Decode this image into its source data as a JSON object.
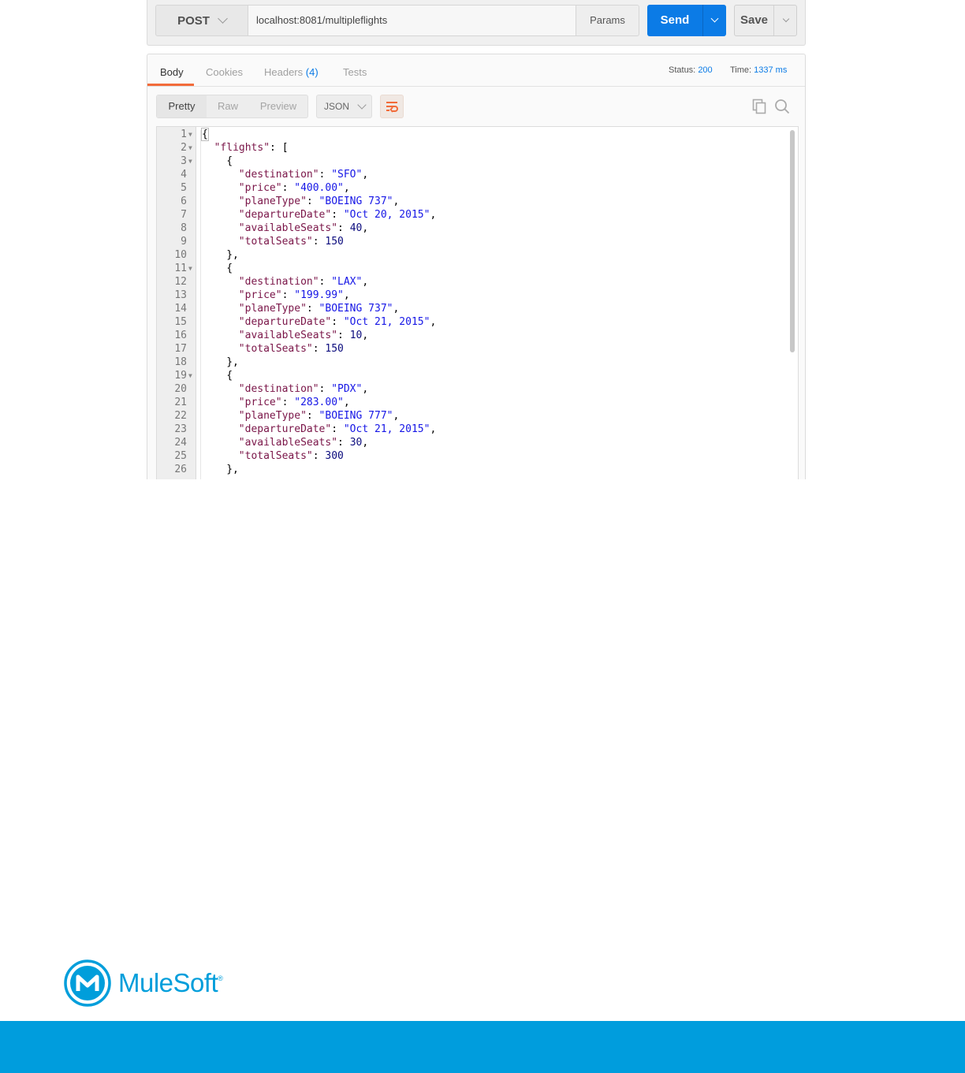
{
  "request": {
    "method": "POST",
    "url": "localhost:8081/multipleflights",
    "params_label": "Params",
    "send_label": "Send",
    "save_label": "Save"
  },
  "response": {
    "tabs": [
      {
        "label": "Body",
        "active": true
      },
      {
        "label": "Cookies"
      },
      {
        "label": "Headers",
        "count": "(4)"
      },
      {
        "label": "Tests"
      }
    ],
    "status_label": "Status:",
    "status_value": "200",
    "time_label": "Time:",
    "time_value": "1337 ms",
    "view_modes": [
      "Pretty",
      "Raw",
      "Preview"
    ],
    "format": "JSON",
    "icons": [
      "wrap-lines-icon",
      "copy-icon",
      "search-icon"
    ]
  },
  "editor": {
    "lines": [
      {
        "n": "1",
        "fold": true,
        "indent": 0,
        "parts": [
          {
            "t": "p",
            "v": "{"
          }
        ]
      },
      {
        "n": "2",
        "fold": true,
        "indent": 1,
        "parts": [
          {
            "t": "k",
            "v": "\"flights\""
          },
          {
            "t": "p",
            "v": ": ["
          }
        ]
      },
      {
        "n": "3",
        "fold": true,
        "indent": 2,
        "parts": [
          {
            "t": "p",
            "v": "{"
          }
        ]
      },
      {
        "n": "4",
        "indent": 3,
        "parts": [
          {
            "t": "k",
            "v": "\"destination\""
          },
          {
            "t": "p",
            "v": ": "
          },
          {
            "t": "s",
            "v": "\"SFO\""
          },
          {
            "t": "p",
            "v": ","
          }
        ]
      },
      {
        "n": "5",
        "indent": 3,
        "parts": [
          {
            "t": "k",
            "v": "\"price\""
          },
          {
            "t": "p",
            "v": ": "
          },
          {
            "t": "s",
            "v": "\"400.00\""
          },
          {
            "t": "p",
            "v": ","
          }
        ]
      },
      {
        "n": "6",
        "indent": 3,
        "parts": [
          {
            "t": "k",
            "v": "\"planeType\""
          },
          {
            "t": "p",
            "v": ": "
          },
          {
            "t": "s",
            "v": "\"BOEING 737\""
          },
          {
            "t": "p",
            "v": ","
          }
        ]
      },
      {
        "n": "7",
        "indent": 3,
        "parts": [
          {
            "t": "k",
            "v": "\"departureDate\""
          },
          {
            "t": "p",
            "v": ": "
          },
          {
            "t": "s",
            "v": "\"Oct 20, 2015\""
          },
          {
            "t": "p",
            "v": ","
          }
        ]
      },
      {
        "n": "8",
        "indent": 3,
        "parts": [
          {
            "t": "k",
            "v": "\"availableSeats\""
          },
          {
            "t": "p",
            "v": ": "
          },
          {
            "t": "n",
            "v": "40"
          },
          {
            "t": "p",
            "v": ","
          }
        ]
      },
      {
        "n": "9",
        "indent": 3,
        "parts": [
          {
            "t": "k",
            "v": "\"totalSeats\""
          },
          {
            "t": "p",
            "v": ": "
          },
          {
            "t": "n",
            "v": "150"
          }
        ]
      },
      {
        "n": "10",
        "indent": 2,
        "parts": [
          {
            "t": "p",
            "v": "},"
          }
        ]
      },
      {
        "n": "11",
        "fold": true,
        "indent": 2,
        "parts": [
          {
            "t": "p",
            "v": "{"
          }
        ]
      },
      {
        "n": "12",
        "indent": 3,
        "parts": [
          {
            "t": "k",
            "v": "\"destination\""
          },
          {
            "t": "p",
            "v": ": "
          },
          {
            "t": "s",
            "v": "\"LAX\""
          },
          {
            "t": "p",
            "v": ","
          }
        ]
      },
      {
        "n": "13",
        "indent": 3,
        "parts": [
          {
            "t": "k",
            "v": "\"price\""
          },
          {
            "t": "p",
            "v": ": "
          },
          {
            "t": "s",
            "v": "\"199.99\""
          },
          {
            "t": "p",
            "v": ","
          }
        ]
      },
      {
        "n": "14",
        "indent": 3,
        "parts": [
          {
            "t": "k",
            "v": "\"planeType\""
          },
          {
            "t": "p",
            "v": ": "
          },
          {
            "t": "s",
            "v": "\"BOEING 737\""
          },
          {
            "t": "p",
            "v": ","
          }
        ]
      },
      {
        "n": "15",
        "indent": 3,
        "parts": [
          {
            "t": "k",
            "v": "\"departureDate\""
          },
          {
            "t": "p",
            "v": ": "
          },
          {
            "t": "s",
            "v": "\"Oct 21, 2015\""
          },
          {
            "t": "p",
            "v": ","
          }
        ]
      },
      {
        "n": "16",
        "indent": 3,
        "parts": [
          {
            "t": "k",
            "v": "\"availableSeats\""
          },
          {
            "t": "p",
            "v": ": "
          },
          {
            "t": "n",
            "v": "10"
          },
          {
            "t": "p",
            "v": ","
          }
        ]
      },
      {
        "n": "17",
        "indent": 3,
        "parts": [
          {
            "t": "k",
            "v": "\"totalSeats\""
          },
          {
            "t": "p",
            "v": ": "
          },
          {
            "t": "n",
            "v": "150"
          }
        ]
      },
      {
        "n": "18",
        "indent": 2,
        "parts": [
          {
            "t": "p",
            "v": "},"
          }
        ]
      },
      {
        "n": "19",
        "fold": true,
        "indent": 2,
        "parts": [
          {
            "t": "p",
            "v": "{"
          }
        ]
      },
      {
        "n": "20",
        "indent": 3,
        "parts": [
          {
            "t": "k",
            "v": "\"destination\""
          },
          {
            "t": "p",
            "v": ": "
          },
          {
            "t": "s",
            "v": "\"PDX\""
          },
          {
            "t": "p",
            "v": ","
          }
        ]
      },
      {
        "n": "21",
        "indent": 3,
        "parts": [
          {
            "t": "k",
            "v": "\"price\""
          },
          {
            "t": "p",
            "v": ": "
          },
          {
            "t": "s",
            "v": "\"283.00\""
          },
          {
            "t": "p",
            "v": ","
          }
        ]
      },
      {
        "n": "22",
        "indent": 3,
        "parts": [
          {
            "t": "k",
            "v": "\"planeType\""
          },
          {
            "t": "p",
            "v": ": "
          },
          {
            "t": "s",
            "v": "\"BOEING 777\""
          },
          {
            "t": "p",
            "v": ","
          }
        ]
      },
      {
        "n": "23",
        "indent": 3,
        "parts": [
          {
            "t": "k",
            "v": "\"departureDate\""
          },
          {
            "t": "p",
            "v": ": "
          },
          {
            "t": "s",
            "v": "\"Oct 21, 2015\""
          },
          {
            "t": "p",
            "v": ","
          }
        ]
      },
      {
        "n": "24",
        "indent": 3,
        "parts": [
          {
            "t": "k",
            "v": "\"availableSeats\""
          },
          {
            "t": "p",
            "v": ": "
          },
          {
            "t": "n",
            "v": "30"
          },
          {
            "t": "p",
            "v": ","
          }
        ]
      },
      {
        "n": "25",
        "indent": 3,
        "parts": [
          {
            "t": "k",
            "v": "\"totalSeats\""
          },
          {
            "t": "p",
            "v": ": "
          },
          {
            "t": "n",
            "v": "300"
          }
        ]
      },
      {
        "n": "26",
        "indent": 2,
        "parts": [
          {
            "t": "p",
            "v": "},"
          }
        ]
      }
    ]
  },
  "branding": {
    "logo_text": "MuleSoft",
    "logo_mark": "®",
    "logo_icon": "mulesoft-logo-icon",
    "brand_color": "#009ddd"
  },
  "colors": {
    "send_button": "#0b7be6",
    "active_tab_underline": "#f26b3a",
    "json_key": "#7a1548",
    "json_string": "#1616e6",
    "json_number": "#0c0c7e"
  }
}
